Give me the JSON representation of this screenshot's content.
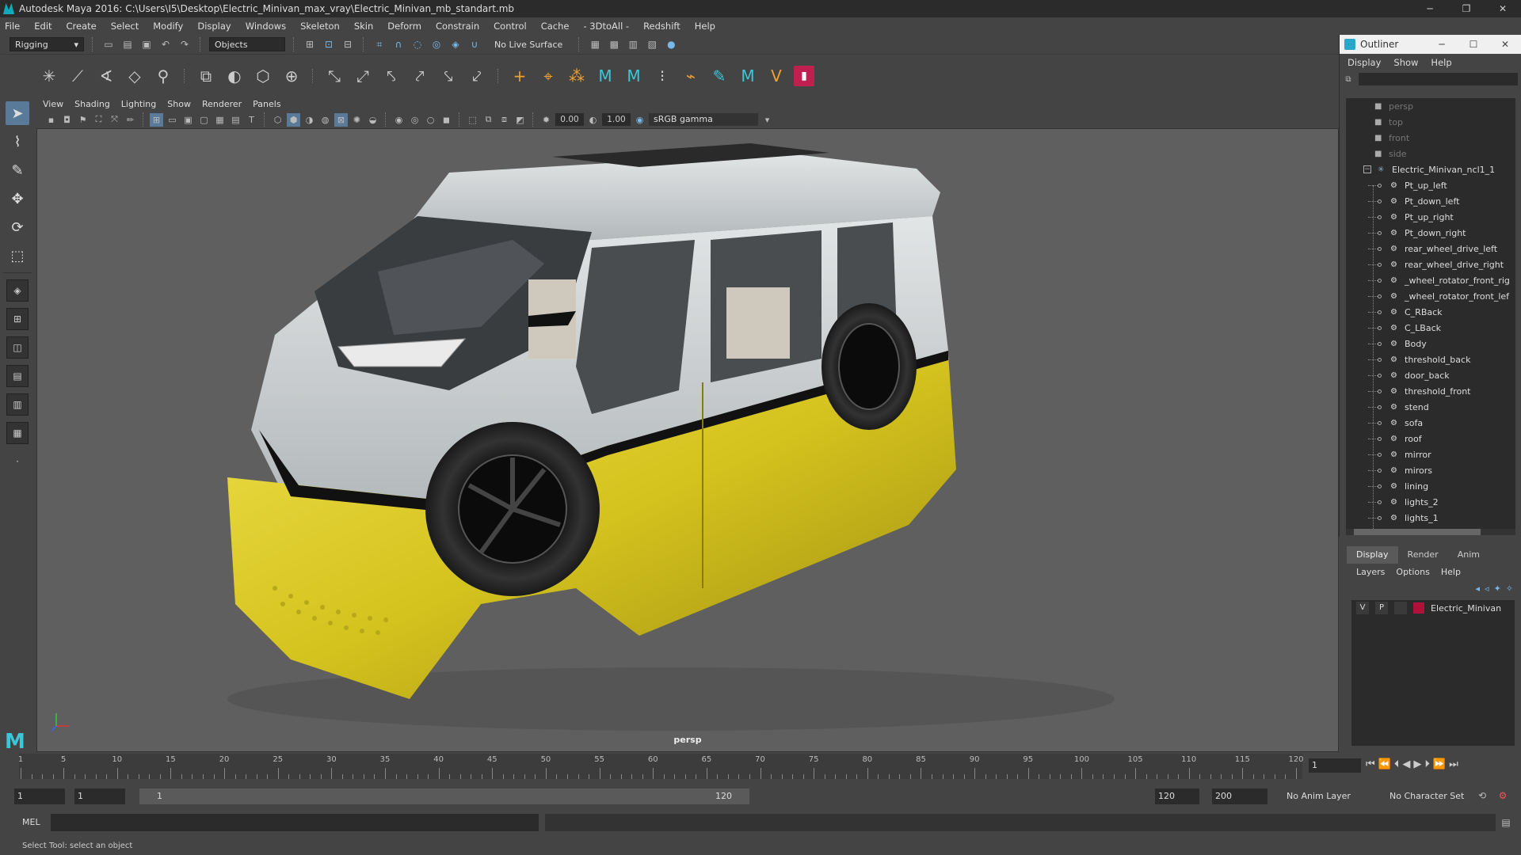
{
  "window": {
    "title": "Autodesk Maya 2016: C:\\Users\\I5\\Desktop\\Electric_Minivan_max_vray\\Electric_Minivan_mb_standart.mb",
    "minimize": "─",
    "maximize": "❐",
    "close": "✕"
  },
  "menubar": [
    "File",
    "Edit",
    "Create",
    "Select",
    "Modify",
    "Display",
    "Windows",
    "Skeleton",
    "Skin",
    "Deform",
    "Constrain",
    "Control",
    "Cache",
    "- 3DtoAll -",
    "Redshift",
    "Help"
  ],
  "statusline": {
    "menuset": "Rigging",
    "selection_mode": "Objects",
    "live_surface": "No Live Surface"
  },
  "panel": {
    "menu": [
      "View",
      "Shading",
      "Lighting",
      "Show",
      "Renderer",
      "Panels"
    ],
    "exposure": "0.00",
    "gamma_value": "1.00",
    "color_space": "sRGB gamma",
    "camera": "persp"
  },
  "outliner": {
    "title": "Outliner",
    "menu": [
      "Display",
      "Show",
      "Help"
    ],
    "cameras": [
      "persp",
      "top",
      "front",
      "side"
    ],
    "root": "Electric_Minivan_ncl1_1",
    "children": [
      "Pt_up_left",
      "Pt_down_left",
      "Pt_up_right",
      "Pt_down_right",
      "rear_wheel_drive_left",
      "rear_wheel_drive_right",
      "_wheel_rotator_front_rig",
      "_wheel_rotator_front_lef",
      "C_RBack",
      "C_LBack",
      "Body",
      "threshold_back",
      "door_back",
      "threshold_front",
      "stend",
      "sofa",
      "roof",
      "mirror",
      "mirors",
      "lining",
      "lights_2",
      "lights_1"
    ]
  },
  "layers": {
    "tabs": [
      "Display",
      "Render",
      "Anim"
    ],
    "menu": [
      "Layers",
      "Options",
      "Help"
    ],
    "row": {
      "v": "V",
      "p": "P",
      "name": "Electric_Minivan",
      "color": "#b0103a"
    }
  },
  "timeline": {
    "start": 1,
    "end": 120,
    "step": 5,
    "labels": [
      "1",
      "5",
      "10",
      "15",
      "20",
      "25",
      "30",
      "35",
      "40",
      "45",
      "50",
      "55",
      "60",
      "65",
      "70",
      "75",
      "80",
      "85",
      "90",
      "95",
      "100",
      "105",
      "110",
      "115",
      "120"
    ],
    "current_frame": "1"
  },
  "range": {
    "start_field": "1",
    "anim_start": "1",
    "slider_start": "1",
    "slider_end": "120",
    "range_end": "120",
    "anim_end": "200",
    "anim_layer": "No Anim Layer",
    "character_set": "No Character Set"
  },
  "command": {
    "lang": "MEL"
  },
  "help_line": "Select Tool: select an object",
  "colors": {
    "body_yellow": "#d4c21e",
    "body_white": "#c8ccce",
    "viewport_bg": "#5f5f5f",
    "accent": "#5a7a99"
  }
}
